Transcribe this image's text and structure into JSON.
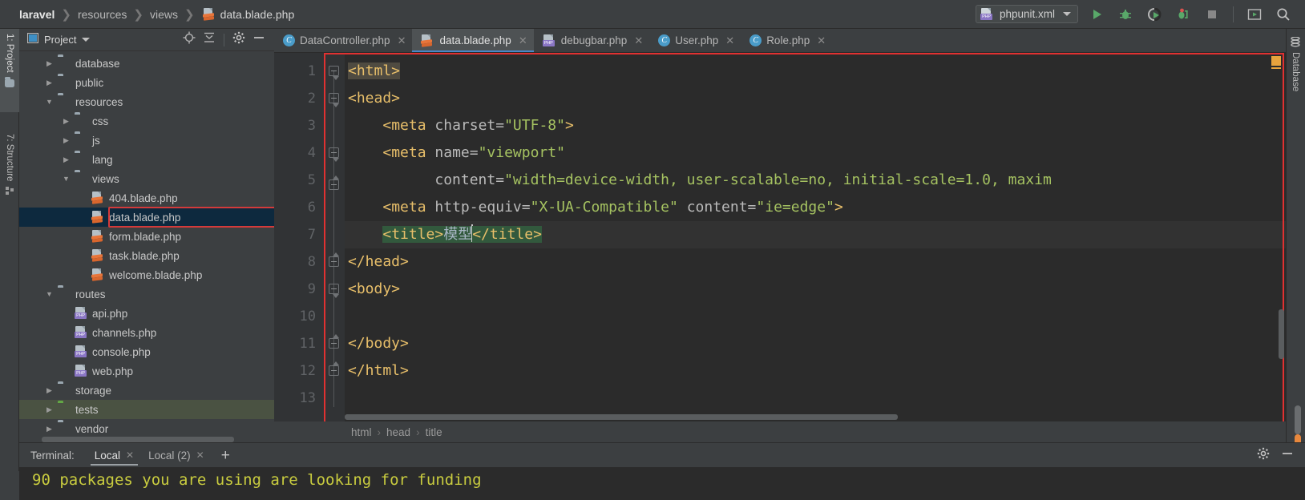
{
  "window": {
    "breadcrumb": [
      "laravel",
      "resources",
      "views"
    ],
    "breadcrumb_file": "data.blade.php",
    "run_config": "phpunit.xml"
  },
  "toolbar": {
    "run_label": "run-icon",
    "debug_label": "debug-icon",
    "coverage_label": "run-with-coverage-icon",
    "profile_label": "profile-icon",
    "stop_label": "stop-icon",
    "restore_label": "restore-layout-icon",
    "search_label": "search-icon"
  },
  "left_strip": {
    "tabs": [
      {
        "label": "1: Project",
        "active": true
      },
      {
        "label": "7: Structure",
        "active": false
      }
    ]
  },
  "right_strip": {
    "tabs": [
      {
        "label": "Database",
        "active": false
      }
    ]
  },
  "project_panel": {
    "title": "Project",
    "tools": [
      "locate-icon",
      "collapse-all-icon",
      "settings-icon",
      "hide-icon"
    ],
    "tree": [
      {
        "label": "database",
        "indent": 1,
        "type": "folder",
        "arrow": "collapsed",
        "state": "none"
      },
      {
        "label": "public",
        "indent": 1,
        "type": "folder",
        "arrow": "collapsed",
        "state": "none"
      },
      {
        "label": "resources",
        "indent": 1,
        "type": "folder",
        "arrow": "expanded",
        "state": "none"
      },
      {
        "label": "css",
        "indent": 2,
        "type": "folder",
        "arrow": "collapsed",
        "state": "none"
      },
      {
        "label": "js",
        "indent": 2,
        "type": "folder",
        "arrow": "collapsed",
        "state": "none"
      },
      {
        "label": "lang",
        "indent": 2,
        "type": "folder",
        "arrow": "collapsed",
        "state": "none"
      },
      {
        "label": "views",
        "indent": 2,
        "type": "folder",
        "arrow": "expanded",
        "state": "none"
      },
      {
        "label": "404.blade.php",
        "indent": 3,
        "type": "blade",
        "arrow": "none",
        "state": "none"
      },
      {
        "label": "data.blade.php",
        "indent": 3,
        "type": "blade",
        "arrow": "none",
        "state": "selected"
      },
      {
        "label": "form.blade.php",
        "indent": 3,
        "type": "blade",
        "arrow": "none",
        "state": "none"
      },
      {
        "label": "task.blade.php",
        "indent": 3,
        "type": "blade",
        "arrow": "none",
        "state": "none"
      },
      {
        "label": "welcome.blade.php",
        "indent": 3,
        "type": "blade",
        "arrow": "none",
        "state": "none"
      },
      {
        "label": "routes",
        "indent": 1,
        "type": "folder",
        "arrow": "expanded",
        "state": "none"
      },
      {
        "label": "api.php",
        "indent": 2,
        "type": "php",
        "arrow": "none",
        "state": "none"
      },
      {
        "label": "channels.php",
        "indent": 2,
        "type": "php",
        "arrow": "none",
        "state": "none"
      },
      {
        "label": "console.php",
        "indent": 2,
        "type": "php",
        "arrow": "none",
        "state": "none"
      },
      {
        "label": "web.php",
        "indent": 2,
        "type": "php",
        "arrow": "none",
        "state": "none"
      },
      {
        "label": "storage",
        "indent": 1,
        "type": "folder",
        "arrow": "collapsed",
        "state": "none"
      },
      {
        "label": "tests",
        "indent": 1,
        "type": "folder-green",
        "arrow": "collapsed",
        "state": "highlight"
      },
      {
        "label": "vendor",
        "indent": 1,
        "type": "folder",
        "arrow": "collapsed",
        "state": "none"
      }
    ]
  },
  "editor": {
    "tabs": [
      {
        "label": "DataController.php",
        "icon": "class-icon",
        "active": false,
        "closable": true
      },
      {
        "label": "data.blade.php",
        "icon": "blade-icon",
        "active": true,
        "closable": true
      },
      {
        "label": "debugbar.php",
        "icon": "php-icon",
        "active": false,
        "closable": true
      },
      {
        "label": "User.php",
        "icon": "class-icon",
        "active": false,
        "closable": true
      },
      {
        "label": "Role.php",
        "icon": "class-icon",
        "active": false,
        "closable": true
      }
    ],
    "line_numbers": [
      "1",
      "2",
      "3",
      "4",
      "5",
      "6",
      "7",
      "8",
      "9",
      "10",
      "11",
      "12",
      "13"
    ],
    "lines": [
      "<html>",
      "<head>",
      "    <meta charset=\"UTF-8\">",
      "    <meta name=\"viewport\"",
      "          content=\"width=device-width, user-scalable=no, initial-scale=1.0, maxim",
      "    <meta http-equiv=\"X-UA-Compatible\" content=\"ie=edge\">",
      "    <title>模型</title>",
      "</head>",
      "<body>",
      "",
      "</body>",
      "</html>",
      ""
    ],
    "title_text": "模型",
    "breadcrumb": [
      "html",
      "head",
      "title"
    ],
    "breadcrumb_sep": "›"
  },
  "terminal": {
    "label": "Terminal:",
    "tabs": [
      {
        "label": "Local",
        "active": true,
        "closable": true
      },
      {
        "label": "Local (2)",
        "active": false,
        "closable": true
      }
    ],
    "add_label": "+",
    "tools": [
      "settings-icon",
      "hide-icon"
    ],
    "output": "90 packages you are using are looking for funding"
  },
  "colors": {
    "accent_red": "#e03131",
    "tab_underline": "#4a88c7",
    "marker_orange": "#e8a33d",
    "terminal_text": "#c9cc3f",
    "selection_green": "#32593d",
    "tree_selection": "#0d293e"
  }
}
